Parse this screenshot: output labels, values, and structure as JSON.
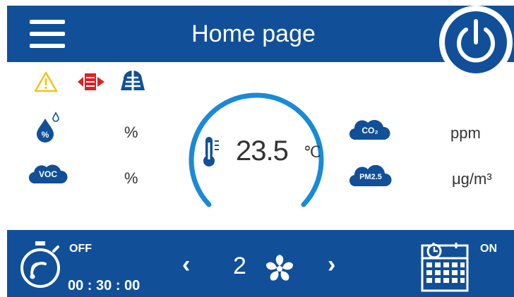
{
  "header": {
    "title": "Home page"
  },
  "readings": {
    "temperature_value": "23.5",
    "temperature_unit": "℃",
    "humidity_unit": "%",
    "voc_unit": "%",
    "co2_unit": "ppm",
    "pm_unit": "μg/m³",
    "voc_badge": "VOC",
    "co2_badge": "CO₂",
    "pm_badge": "PM2.5"
  },
  "timer": {
    "state": "OFF",
    "time": "00 : 30 : 00"
  },
  "fan": {
    "speed": "2",
    "prev_glyph": "‹",
    "next_glyph": "›"
  },
  "schedule": {
    "state": "ON"
  },
  "colors": {
    "primary": "#114f98",
    "gauge": "#1a8ad6",
    "warning": "#f7c21a",
    "alert": "#e02020"
  },
  "icons": [
    "menu-icon",
    "power-icon",
    "warning-icon",
    "heater-icon",
    "filter-icon",
    "humidity-icon",
    "thermometer-icon",
    "timer-icon",
    "fan-icon",
    "schedule-icon"
  ]
}
